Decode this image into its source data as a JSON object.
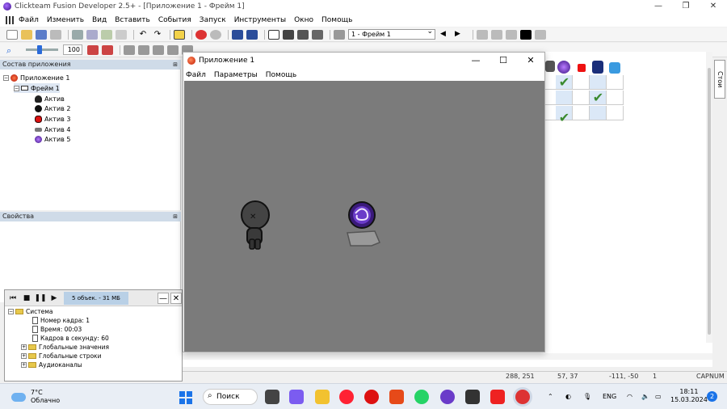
{
  "window": {
    "title": "Clickteam Fusion Developer 2.5+ - [Приложение 1 - Фрейм 1]"
  },
  "menubar": {
    "items": [
      "Файл",
      "Изменить",
      "Вид",
      "Вставить",
      "События",
      "Запуск",
      "Инструменты",
      "Окно",
      "Помощь"
    ]
  },
  "toolbar": {
    "frame_select": "1 - Фрейм 1",
    "zoom": "100"
  },
  "workspace": {
    "header": "Состав приложения",
    "tree": [
      {
        "label": "Приложение 1",
        "level": 0
      },
      {
        "label": "Фрейм 1",
        "level": 1
      },
      {
        "label": "Актив",
        "level": 2
      },
      {
        "label": "Актив 2",
        "level": 2
      },
      {
        "label": "Актив 3",
        "level": 2
      },
      {
        "label": "Актив 4",
        "level": 2
      },
      {
        "label": "Актив 5",
        "level": 2
      }
    ]
  },
  "properties": {
    "header": "Свойства"
  },
  "debugger": {
    "info": "5 объек. - 31 МБ",
    "rows": [
      {
        "label": "Система",
        "type": "folder"
      },
      {
        "label": "Номер кадра: 1",
        "type": "doc"
      },
      {
        "label": "Время: 00:03",
        "type": "doc"
      },
      {
        "label": "Кадров в секунду: 60",
        "type": "doc"
      },
      {
        "label": "Глобальные значения",
        "type": "folder"
      },
      {
        "label": "Глобальные строки",
        "type": "folder"
      },
      {
        "label": "Аудиоканалы",
        "type": "folder"
      }
    ]
  },
  "app_window": {
    "title": "Приложение 1",
    "menu": [
      "Файл",
      "Параметры",
      "Помощь"
    ]
  },
  "right_tab": {
    "label": "Стои"
  },
  "statusbar": {
    "coords1": "288, 251",
    "coords2": "57, 37",
    "coords3": "-111, -50",
    "count": "1",
    "caps": "CAP",
    "num": "NUM"
  },
  "taskbar": {
    "weather_temp": "7°C",
    "weather_desc": "Облачно",
    "search": "Поиск",
    "lang": "ENG",
    "time": "18:11",
    "date": "15.03.2024",
    "notifications": "2"
  }
}
